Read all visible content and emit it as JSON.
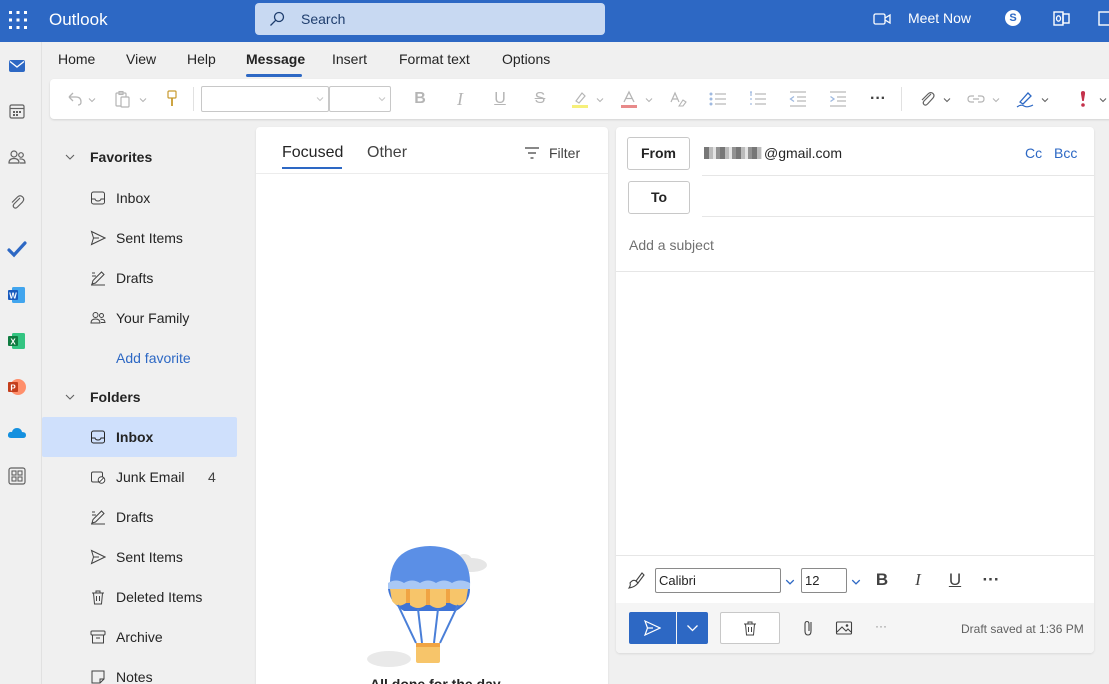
{
  "header": {
    "app_name": "Outlook",
    "search_placeholder": "Search",
    "meet_now_label": "Meet Now",
    "skype_label": "S"
  },
  "ribbon": {
    "tabs": [
      {
        "label": "Home"
      },
      {
        "label": "View"
      },
      {
        "label": "Help"
      },
      {
        "label": "Message",
        "active": true
      },
      {
        "label": "Insert"
      },
      {
        "label": "Format text"
      },
      {
        "label": "Options"
      }
    ],
    "more_label": "···"
  },
  "folders": {
    "favorites_label": "Favorites",
    "favorites": [
      {
        "label": "Inbox",
        "icon": "inbox-icon"
      },
      {
        "label": "Sent Items",
        "icon": "send-icon"
      },
      {
        "label": "Drafts",
        "icon": "pencil-icon"
      },
      {
        "label": "Your Family",
        "icon": "people-icon"
      }
    ],
    "add_favorite_label": "Add favorite",
    "folders_label": "Folders",
    "items": [
      {
        "label": "Inbox",
        "icon": "inbox-icon",
        "selected": true,
        "count": ""
      },
      {
        "label": "Junk Email",
        "icon": "junk-icon",
        "count": "4"
      },
      {
        "label": "Drafts",
        "icon": "pencil-icon",
        "count": ""
      },
      {
        "label": "Sent Items",
        "icon": "send-icon",
        "count": ""
      },
      {
        "label": "Deleted Items",
        "icon": "trash-icon",
        "count": ""
      },
      {
        "label": "Archive",
        "icon": "archive-icon",
        "count": ""
      },
      {
        "label": "Notes",
        "icon": "note-icon",
        "count": ""
      }
    ]
  },
  "message_list": {
    "tab_focused": "Focused",
    "tab_other": "Other",
    "filter_label": "Filter",
    "empty_text": "All done for the day"
  },
  "compose": {
    "from_label": "From",
    "from_address": "@gmail.com",
    "to_label": "To",
    "cc_label": "Cc",
    "bcc_label": "Bcc",
    "subject_placeholder": "Add a subject",
    "font_name": "Calibri",
    "font_size": "12",
    "bold_label": "B",
    "italic_label": "I",
    "underline_label": "U",
    "more_label": "···",
    "draft_status": "Draft saved at 1:36 PM"
  },
  "colors": {
    "accent": "#2d68c4",
    "selected_bg": "#cfe0fc",
    "search_bg": "#c8d9f2"
  }
}
